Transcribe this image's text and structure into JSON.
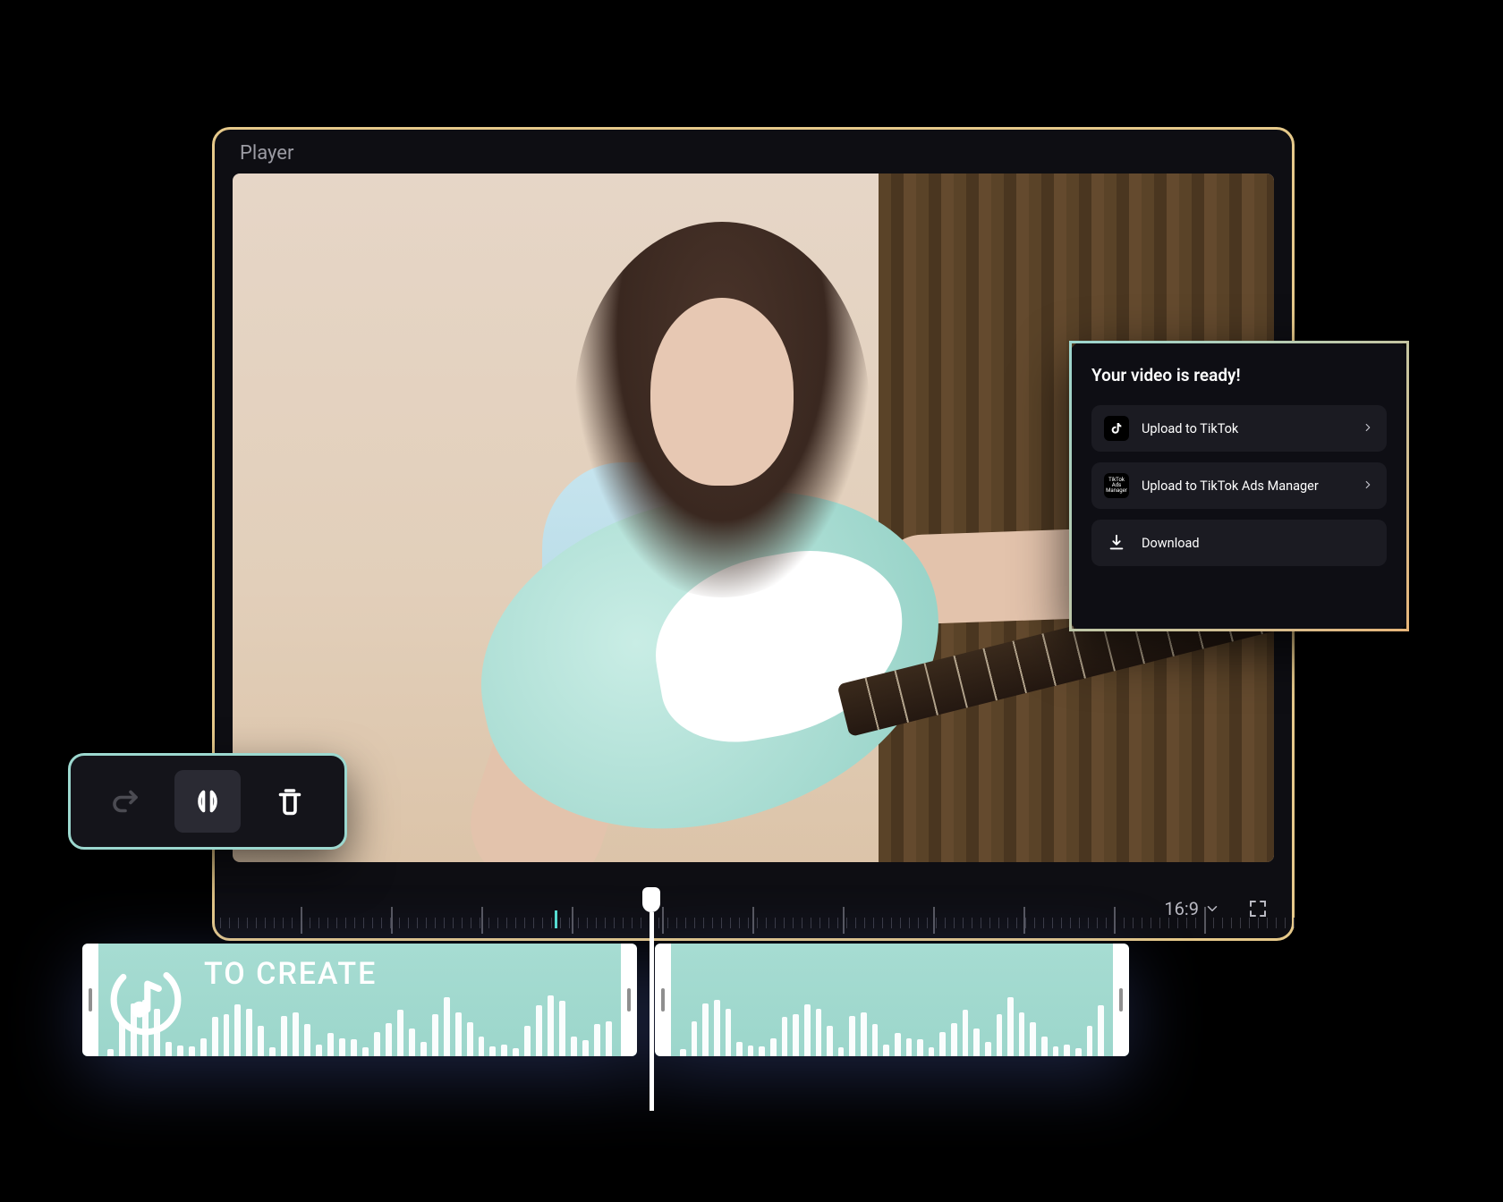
{
  "player": {
    "title": "Player",
    "aspect_ratio": "16:9"
  },
  "export_card": {
    "title": "Your video is ready!",
    "items": [
      {
        "label": "Upload to TikTok"
      },
      {
        "label": "Upload to TikTok Ads Manager"
      },
      {
        "label": "Download"
      }
    ],
    "ads_icon_text": "TikTok Ads Manager"
  },
  "timeline_clip": {
    "label": "TO CREATE"
  }
}
